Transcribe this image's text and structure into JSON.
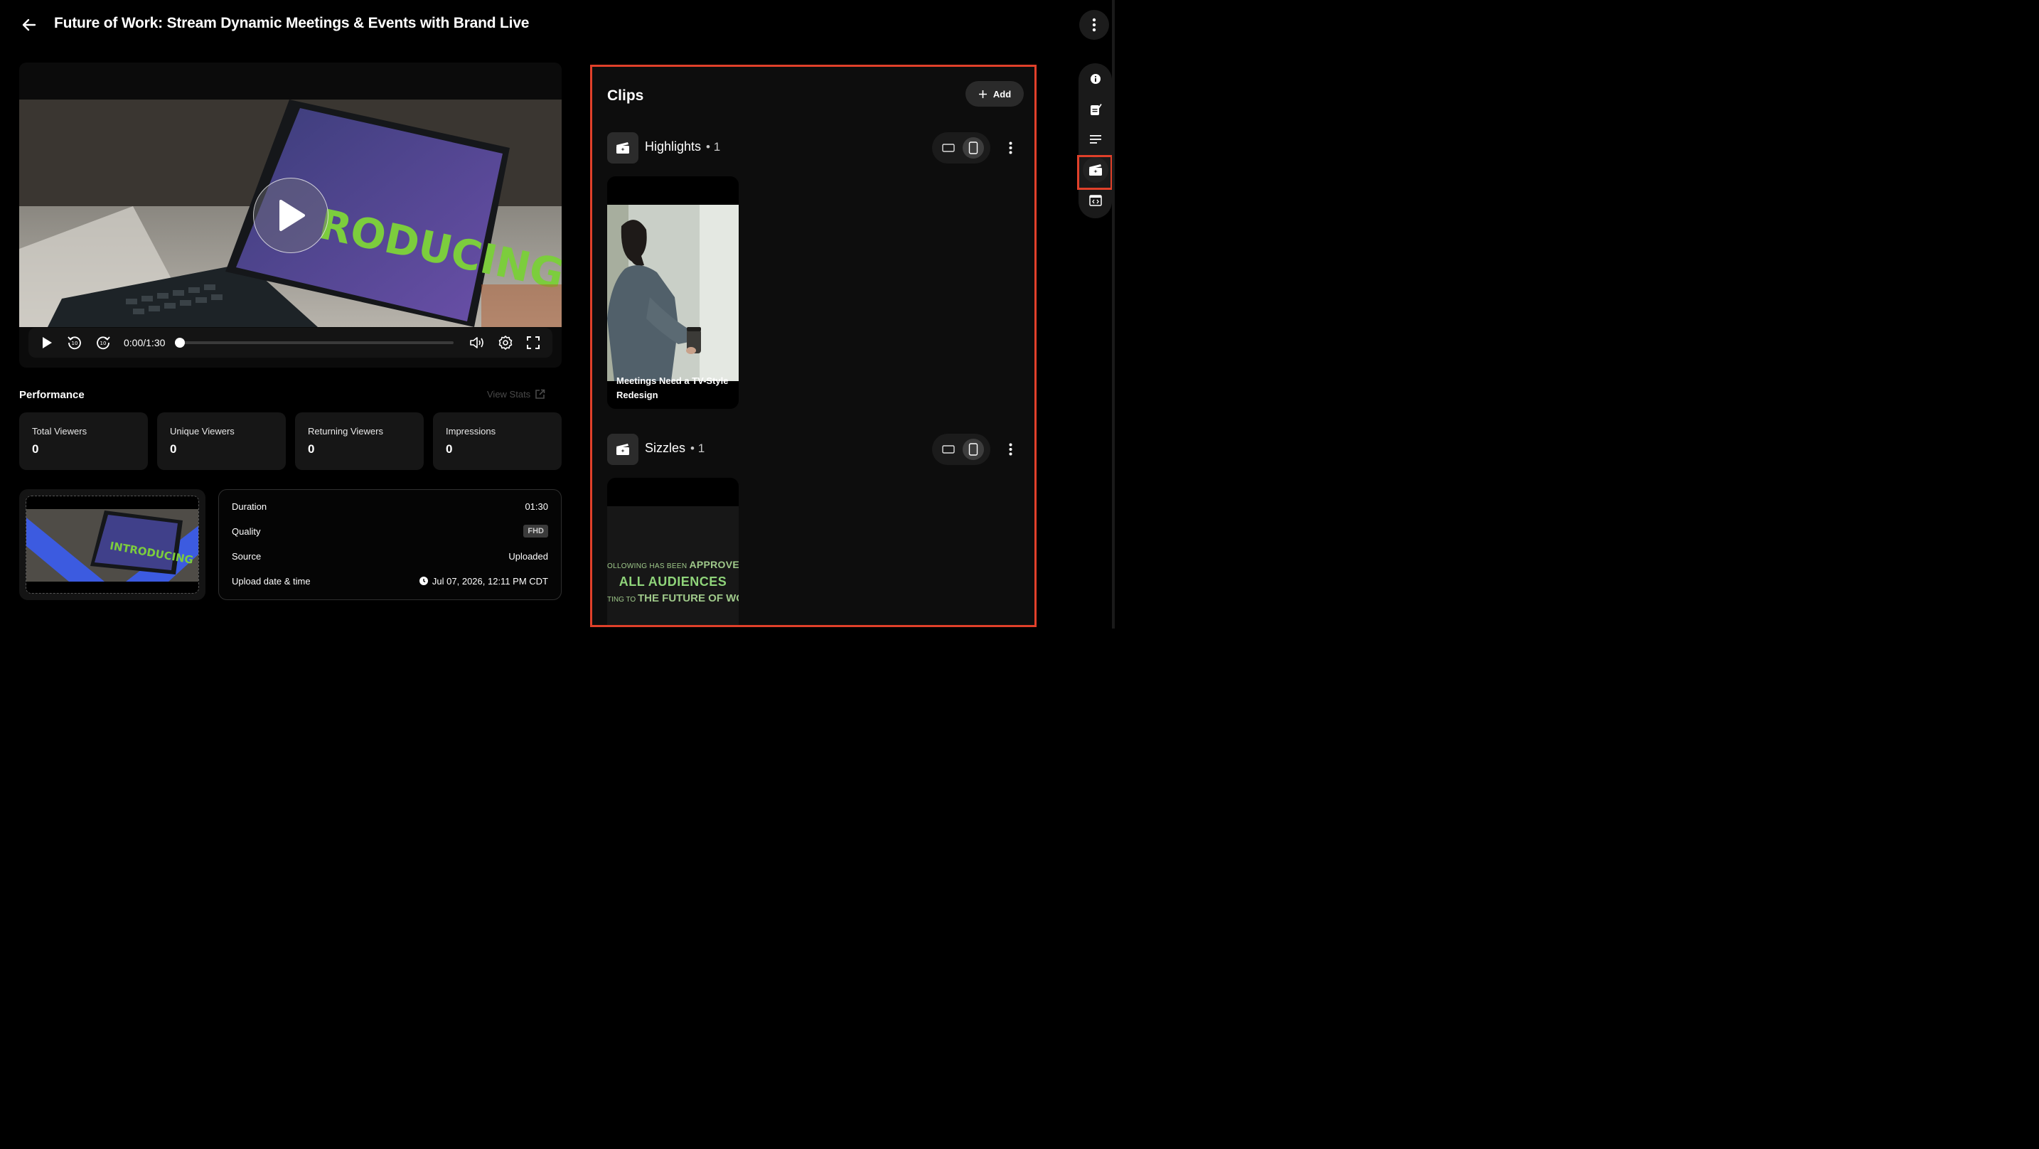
{
  "header": {
    "title": "Future of Work: Stream Dynamic Meetings & Events with Brand Live"
  },
  "player": {
    "time": "0:00/1:30",
    "progress": 0,
    "frame_text": "RODUCING"
  },
  "performance": {
    "title": "Performance",
    "view_stats": "View Stats",
    "stats": [
      {
        "label": "Total Viewers",
        "value": "0"
      },
      {
        "label": "Unique Viewers",
        "value": "0"
      },
      {
        "label": "Returning Viewers",
        "value": "0"
      },
      {
        "label": "Impressions",
        "value": "0"
      }
    ]
  },
  "thumbnail": {
    "text": "INTRODUCING"
  },
  "meta": {
    "duration_label": "Duration",
    "duration": "01:30",
    "quality_label": "Quality",
    "quality": "FHD",
    "source_label": "Source",
    "source": "Uploaded",
    "upload_label": "Upload date & time",
    "upload": "Jul 07, 2026, 12:11 PM CDT"
  },
  "clips": {
    "title": "Clips",
    "add_label": "Add",
    "groups": [
      {
        "name": "Highlights",
        "count": "• 1",
        "clip_caption": "Meetings Need a TV-Style Redesign"
      },
      {
        "name": "Sizzles",
        "count": "• 1",
        "lines": [
          "OLLOWING HAS BEEN",
          "APPROVE",
          "ALL AUDIENCES",
          "TING TO",
          "THE FUTURE OF WO"
        ]
      }
    ]
  },
  "colors": {
    "highlight": "#e0402a",
    "background": "#000000",
    "card": "#161616"
  }
}
